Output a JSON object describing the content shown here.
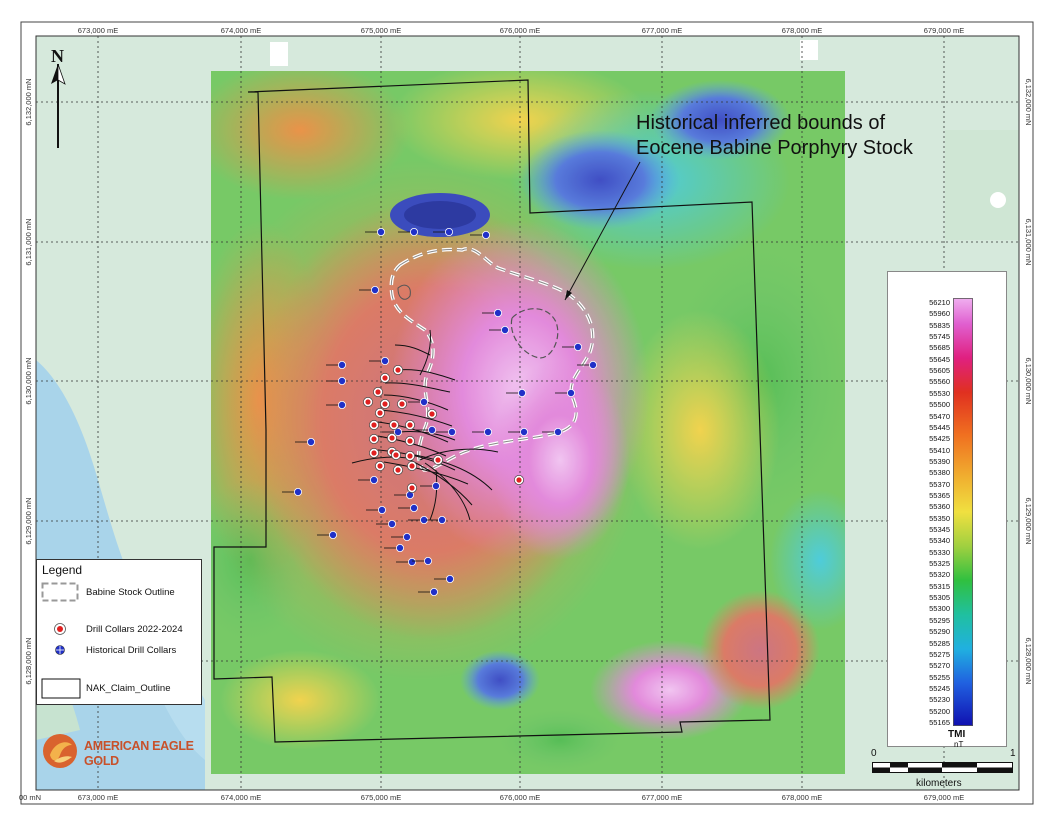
{
  "map": {
    "annotation": {
      "line1": "Historical inferred bounds of",
      "line2": "Eocene Babine Porphyry Stock"
    },
    "north_arrow": {
      "label": "N"
    },
    "eastings_top": [
      "673,000 mE",
      "674,000 mE",
      "675,000 mE",
      "676,000 mE",
      "677,000 mE",
      "678,000 mE",
      "679,000 mE"
    ],
    "eastings_bottom": [
      "00 mN",
      "673,000 mE",
      "674,000 mE",
      "675,000 mE",
      "676,000 mE",
      "677,000 mE",
      "678,000 mE",
      "679,000 mE"
    ],
    "northings_left": [
      "6,132,000 mN",
      "6,131,000 mN",
      "6,130,000 mN",
      "6,129,000 mN",
      "6,128,000 mN"
    ],
    "northings_right": [
      "6,132,000 mN",
      "6,131,000 mN",
      "6,130,000 mN",
      "6,129,000 mN",
      "6,128,000 mN"
    ]
  },
  "legend": {
    "title": "Legend",
    "items": [
      {
        "label": "Babine Stock Outline",
        "symbol": "dashed-outline"
      },
      {
        "label": "Drill Collars 2022-2024",
        "symbol": "red-dot-icon"
      },
      {
        "label": "Historical Drill Collars",
        "symbol": "blue-dot-icon"
      },
      {
        "label": "NAK_Claim_Outline",
        "symbol": "black-outline"
      }
    ]
  },
  "tmi_scale": {
    "title": "TMI",
    "unit": "nT",
    "values": [
      "56210",
      "55960",
      "55835",
      "55745",
      "55685",
      "55645",
      "55605",
      "55560",
      "55530",
      "55500",
      "55470",
      "55445",
      "55425",
      "55410",
      "55390",
      "55380",
      "55370",
      "55365",
      "55360",
      "55350",
      "55345",
      "55340",
      "55330",
      "55325",
      "55320",
      "55315",
      "55305",
      "55300",
      "55295",
      "55290",
      "55285",
      "55275",
      "55270",
      "55255",
      "55245",
      "55230",
      "55200",
      "55165"
    ]
  },
  "scale_bar": {
    "start": "0",
    "end": "1",
    "unit": "kilometers"
  },
  "logo": {
    "line1": "AMERICAN EAGLE",
    "line2": "GOLD"
  },
  "colors": {
    "drill_new": "#e02020",
    "drill_historic": "#2030c8",
    "claim": "#111111",
    "stock_outline": "#bbbbbb",
    "brand": "#c8512a"
  }
}
